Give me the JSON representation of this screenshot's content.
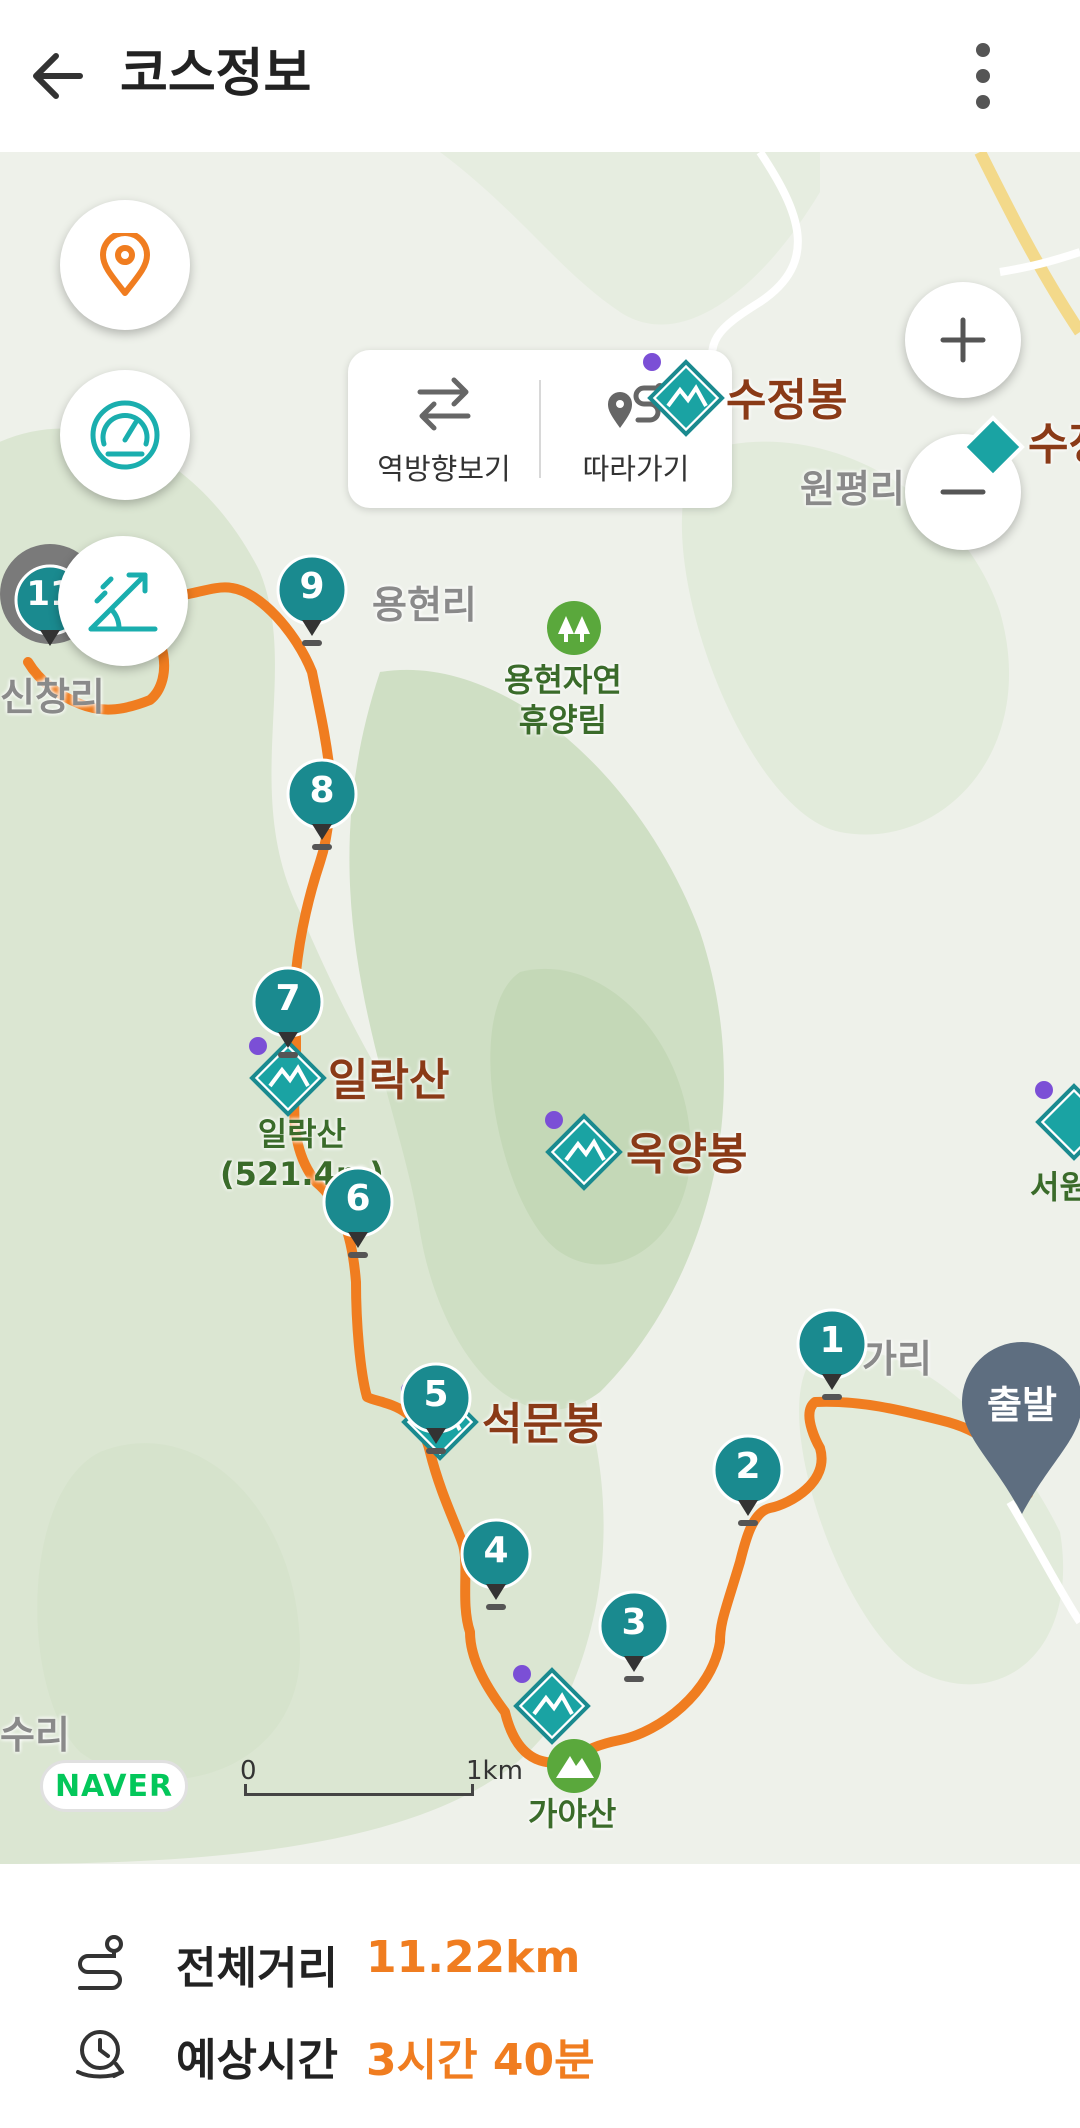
{
  "header": {
    "title": "코스정보",
    "back_icon": "arrow-left-icon",
    "menu_icon": "more-vertical-icon"
  },
  "map": {
    "toolbar": {
      "reverse_label": "역방향보기",
      "follow_label": "따라가기"
    },
    "zoom_in_label": "+",
    "zoom_out_label": "−",
    "peaks": {
      "sujeongbong": "수정봉",
      "sujeong_partial": "수정",
      "illaksan": "일락산",
      "okyangbong": "옥양봉",
      "seokmunbong": "석문봉",
      "seowon_partial": "서원"
    },
    "villages": {
      "yonghyeonri": "용현리",
      "wonpyeongri": "원평리",
      "sinchangri_partial": "신창리",
      "gari_partial": "가리",
      "suri_partial": "수리"
    },
    "green_places": {
      "forest_name": "용현자연\n휴양림",
      "gayasan": "가야산",
      "illaksan_elev": "일락산\n(521.4m)"
    },
    "waypoints": [
      "1",
      "2",
      "3",
      "4",
      "5",
      "6",
      "7",
      "8",
      "9",
      "11"
    ],
    "start_label": "출발",
    "naver_logo": "NAVER",
    "scale": {
      "zero": "0",
      "one": "1km"
    },
    "colors": {
      "route": "#f07d20",
      "marker": "#1a8a8f",
      "accent": "#f07d20"
    }
  },
  "summary": {
    "distance_label": "전체거리",
    "distance_value": "11.22km",
    "time_label": "예상시간",
    "time_value": "3시간 40분"
  }
}
